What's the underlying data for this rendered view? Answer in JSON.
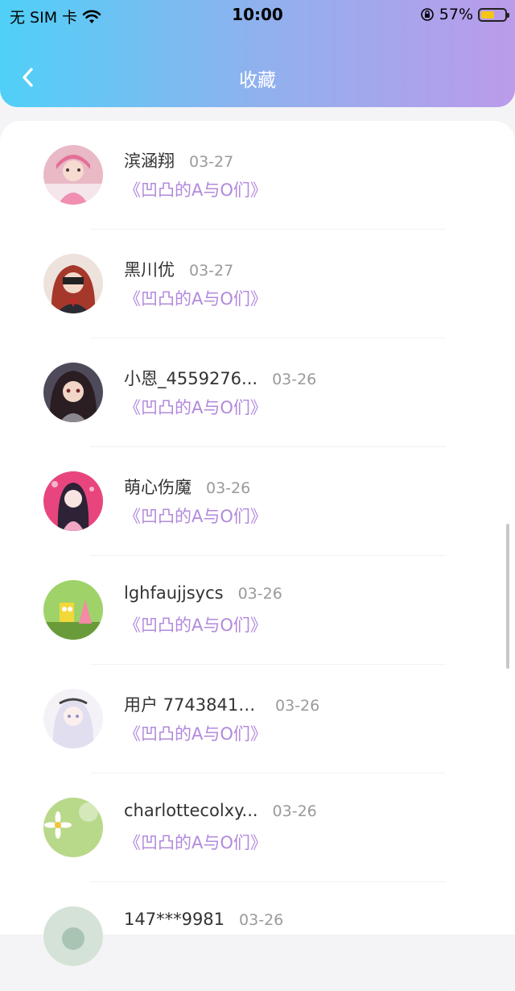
{
  "status_bar": {
    "carrier": "无 SIM 卡",
    "time": "10:00",
    "battery": "57%",
    "battery_level": 0.57
  },
  "header": {
    "title": "收藏"
  },
  "items": [
    {
      "name": "滨涵翔",
      "date": "03-27",
      "book": "《凹凸的A与O们》",
      "avatar_icon": "avatar-pink-girl"
    },
    {
      "name": "黑川优",
      "date": "03-27",
      "book": "《凹凸的A与O们》",
      "avatar_icon": "avatar-red-hair"
    },
    {
      "name": "小恩_4559276...",
      "date": "03-26",
      "book": "《凹凸的A与O们》",
      "avatar_icon": "avatar-anime-dark"
    },
    {
      "name": "萌心伤魔",
      "date": "03-26",
      "book": "《凹凸的A与O们》",
      "avatar_icon": "avatar-anime-pink"
    },
    {
      "name": "lghfaujjsycs",
      "date": "03-26",
      "book": "《凹凸的A与O们》",
      "avatar_icon": "avatar-spongebob"
    },
    {
      "name": "用户 77438410...",
      "date": "03-26",
      "book": "《凹凸的A与O们》",
      "avatar_icon": "avatar-white-doll"
    },
    {
      "name": "charlottecolxy...",
      "date": "03-26",
      "book": "《凹凸的A与O们》",
      "avatar_icon": "avatar-daisy"
    },
    {
      "name": "147***9981",
      "date": "03-26",
      "book": "",
      "avatar_icon": "avatar-partial"
    }
  ],
  "colors": {
    "accent": "#b289dc",
    "header_start": "#4fd0f7",
    "header_end": "#bb9bea"
  }
}
